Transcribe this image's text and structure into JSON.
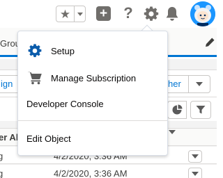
{
  "header": {
    "favorites_star": "★",
    "add_symbol": "+",
    "help_symbol": "?"
  },
  "background": {
    "tab_partial": "Grou",
    "left_button_partial": "ign",
    "right_button_partial": "her",
    "column_header_partial": "er Al",
    "rows": [
      {
        "left": "g",
        "date": "4/2/2020, 3:36 AM"
      },
      {
        "left": "g",
        "date": "4/2/2020, 3:36 AM"
      }
    ]
  },
  "setup_menu": {
    "items": [
      {
        "label": "Setup",
        "icon": "gear-icon"
      },
      {
        "label": "Manage Subscription",
        "icon": "cart-icon"
      },
      {
        "label": "Developer Console"
      },
      {
        "label": "Edit Object"
      }
    ]
  },
  "colors": {
    "brand_blue": "#0176d3",
    "icon_gray": "#706e6b",
    "setup_icon_blue": "#0b5cab",
    "avatar_blue": "#1b96ff"
  }
}
